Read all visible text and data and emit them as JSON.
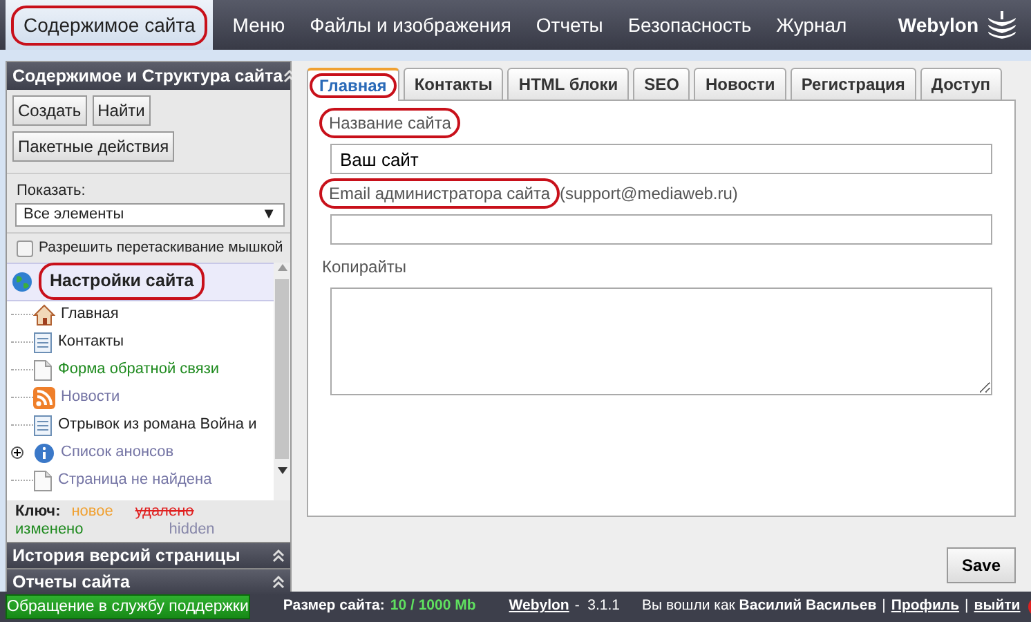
{
  "top_menu": {
    "items": [
      {
        "label": "Содержимое сайта",
        "selected": true,
        "circled": true
      },
      {
        "label": "Меню",
        "selected": false,
        "circled": false
      },
      {
        "label": "Файлы и изображения",
        "selected": false,
        "circled": false
      },
      {
        "label": "Отчеты",
        "selected": false,
        "circled": false
      },
      {
        "label": "Безопасность",
        "selected": false,
        "circled": false
      },
      {
        "label": "Журнал",
        "selected": false,
        "circled": false
      }
    ],
    "brand": "Webylon"
  },
  "sidebar": {
    "title": "Содержимое и Структура сайта",
    "buttons": [
      "Создать",
      "Найти",
      "Пакетные действия"
    ],
    "show_label": "Показать:",
    "show_value": "Все элементы",
    "select_caret": "▼",
    "drag_checkbox": {
      "label": "Разрешить перетаскивание мышкой",
      "checked": false
    },
    "tree": {
      "label": "Настройки сайта",
      "circled": true,
      "selected": true,
      "kind": "globe",
      "children": [
        {
          "label": "Главная",
          "kind": "home",
          "color": "#222222"
        },
        {
          "label": "Контакты",
          "kind": "page",
          "color": "#222222"
        },
        {
          "label": "Форма обратной связи",
          "kind": "blank",
          "color": "#1e8a1e"
        },
        {
          "label": "Новости",
          "kind": "feed",
          "color": "#7575a5"
        },
        {
          "label": "Отрывок из романа Война и",
          "kind": "page",
          "color": "#222222"
        },
        {
          "label": "Список анонсов",
          "kind": "info",
          "color": "#7575a5",
          "expanded": false
        },
        {
          "label": "Страница не найдена",
          "kind": "blank",
          "color": "#7575a5"
        }
      ]
    },
    "legend": {
      "label": "Ключ:",
      "items": [
        {
          "label": "новое",
          "kind": "new"
        },
        {
          "label": "удалено",
          "kind": "deleted"
        },
        {
          "label": "изменено",
          "kind": "changed"
        },
        {
          "label": "hidden",
          "kind": "hidden"
        }
      ]
    },
    "panels": [
      "История версий страницы",
      "Отчеты сайта"
    ]
  },
  "tabs": [
    {
      "label": "Главная",
      "selected": true,
      "circled": true
    },
    {
      "label": "Контакты",
      "selected": false,
      "circled": false
    },
    {
      "label": "HTML блоки",
      "selected": false,
      "circled": false
    },
    {
      "label": "SEO",
      "selected": false,
      "circled": false
    },
    {
      "label": "Новости",
      "selected": false,
      "circled": false
    },
    {
      "label": "Регистрация",
      "selected": false,
      "circled": false
    },
    {
      "label": "Доступ",
      "selected": false,
      "circled": false
    }
  ],
  "form": {
    "fields": [
      {
        "label": "Название сайта",
        "circled": true,
        "kind": "input",
        "value": "Ваш сайт"
      },
      {
        "label": "Email администратора сайта",
        "circled": true,
        "hint": "(support@mediaweb.ru)",
        "kind": "input"
      },
      {
        "label": "Копирайты",
        "circled": false,
        "kind": "textarea"
      }
    ],
    "save": "Save"
  },
  "footer": {
    "support": "Обращение в службу поддержки",
    "size_label": "Размер сайта:",
    "size_value": "10 / 1000 Mb",
    "product": "Webylon",
    "version": "-  3.1.1",
    "user": "Вы вошли как **Василий Васильев**",
    "separator": "|",
    "links": [
      "Профиль",
      "выйти"
    ]
  }
}
